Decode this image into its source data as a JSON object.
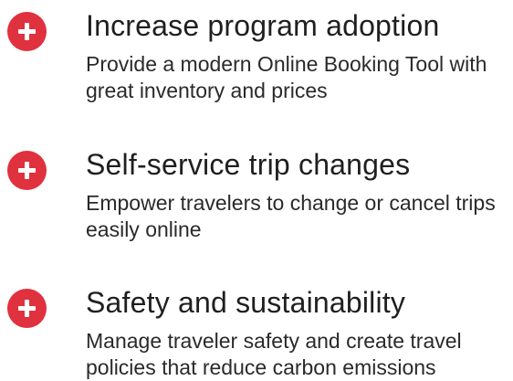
{
  "colors": {
    "accent": "#e0313e",
    "text": "#1f1f1f"
  },
  "features": [
    {
      "icon": "plus-circle-icon",
      "title": "Increase program adoption",
      "description": "Provide a modern Online Booking Tool with great inventory and prices"
    },
    {
      "icon": "plus-circle-icon",
      "title": "Self-service trip changes",
      "description": "Empower travelers to change or cancel trips easily online"
    },
    {
      "icon": "plus-circle-icon",
      "title": "Safety and sustainability",
      "description": "Manage traveler safety and create travel policies that reduce carbon emissions"
    }
  ]
}
